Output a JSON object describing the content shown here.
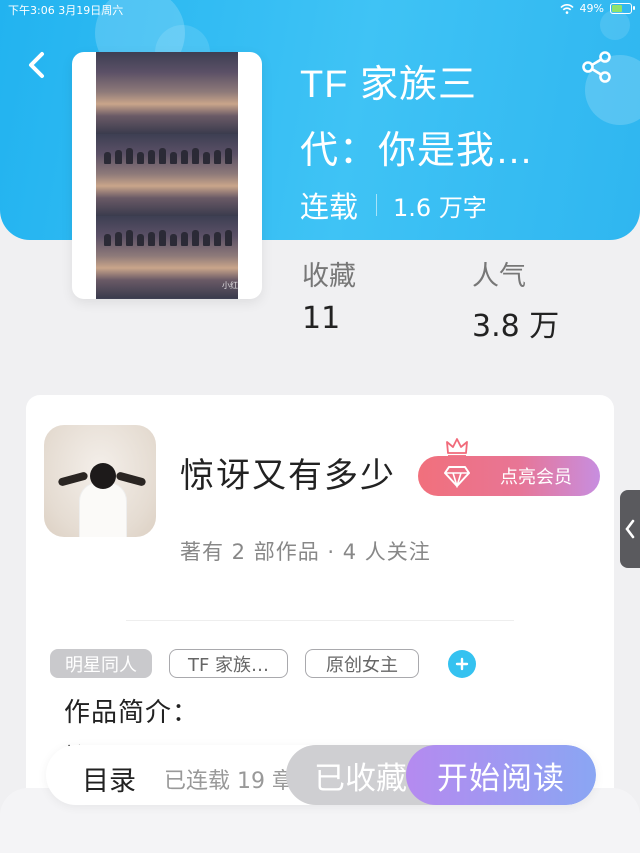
{
  "status_bar": {
    "time_date": "下午3:06   3月19日周六",
    "battery_text": "49%",
    "battery_level": 0.49
  },
  "book": {
    "title_line1": "TF 家族三",
    "title_line2": "代：你是我…",
    "status": "连载",
    "word_count": "1.6 万字",
    "cover_caption": "小红书号"
  },
  "stats": {
    "favorites_label": "收藏",
    "favorites_value": "11",
    "popularity_label": "人气",
    "popularity_value": "3.8 万"
  },
  "author": {
    "name": "惊讶又有多少",
    "vip_label": "点亮会员",
    "summary": "著有 2 部作品 · 4 人关注"
  },
  "tags": [
    "明星同人",
    "TF 家族…",
    "原创女主"
  ],
  "intro": {
    "label": "作品简介：",
    "peek": "炫目 一切乐园"
  },
  "bottom_bar": {
    "toc_label": "目录",
    "toc_status": "已连载 19 章",
    "favorited_label": "已收藏",
    "read_label": "开始阅读"
  },
  "colors": {
    "header_blue": "#22b3f0",
    "tag_add_blue": "#35c2f0",
    "vip_pink": "#f1707c",
    "read_purple": "#b58af0"
  },
  "icons": {
    "back": "chevron-left-icon",
    "share": "share-icon",
    "vip": "diamond-icon",
    "crown": "crown-icon",
    "handle": "chevron-left-icon",
    "add_tag": "plus-icon"
  }
}
